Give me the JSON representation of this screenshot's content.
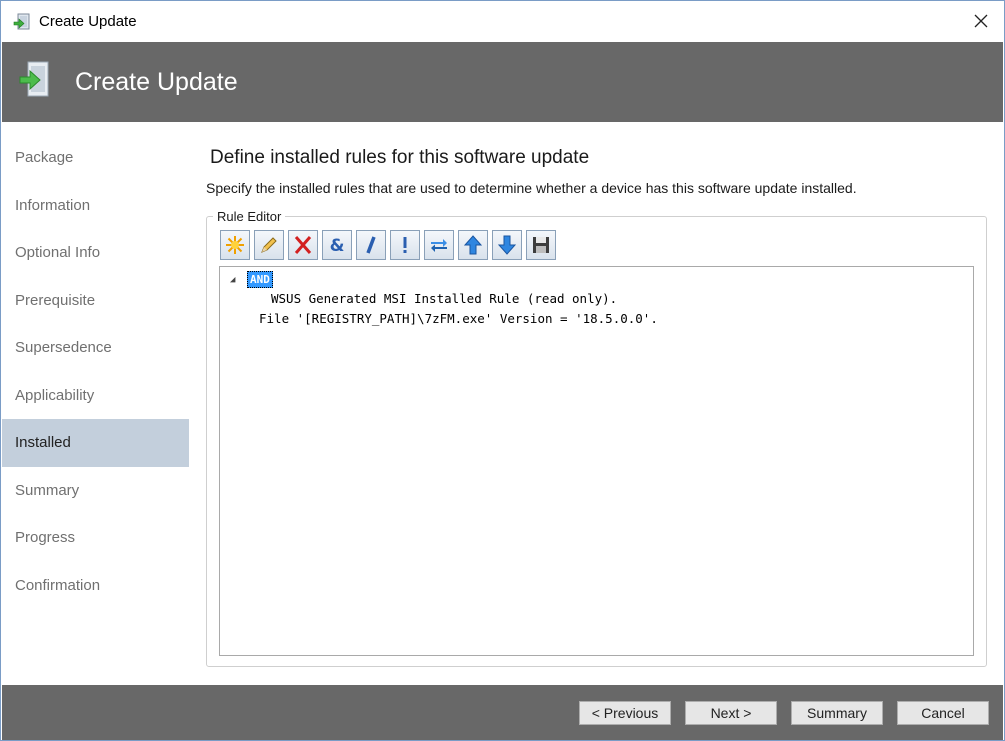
{
  "window": {
    "title": "Create Update"
  },
  "banner": {
    "title": "Create Update"
  },
  "nav": {
    "items": [
      {
        "label": "Package"
      },
      {
        "label": "Information"
      },
      {
        "label": "Optional Info"
      },
      {
        "label": "Prerequisite"
      },
      {
        "label": "Supersedence"
      },
      {
        "label": "Applicability"
      },
      {
        "label": "Installed",
        "active": true
      },
      {
        "label": "Summary"
      },
      {
        "label": "Progress"
      },
      {
        "label": "Confirmation"
      }
    ]
  },
  "content": {
    "heading": "Define installed rules for this software update",
    "description": "Specify the installed rules that are used to determine whether a device has this software update installed.",
    "group_label": "Rule Editor",
    "toolbar": [
      {
        "icon": "new-rule-icon"
      },
      {
        "icon": "edit-rule-icon"
      },
      {
        "icon": "delete-rule-icon"
      },
      {
        "icon": "and-icon"
      },
      {
        "icon": "or-icon"
      },
      {
        "icon": "not-icon"
      },
      {
        "icon": "swap-icon"
      },
      {
        "icon": "move-up-icon"
      },
      {
        "icon": "move-down-icon"
      },
      {
        "icon": "save-icon"
      }
    ],
    "tree": {
      "root": "AND",
      "lines": [
        "WSUS Generated MSI Installed Rule (read only).",
        "File '[REGISTRY_PATH]\\7zFM.exe' Version = '18.5.0.0'."
      ]
    }
  },
  "footer": {
    "previous": "< Previous",
    "next": "Next >",
    "summary": "Summary",
    "cancel": "Cancel"
  },
  "colors": {
    "banner": "#686868",
    "nav_active": "#c3cfdc",
    "selection": "#3399ff"
  }
}
